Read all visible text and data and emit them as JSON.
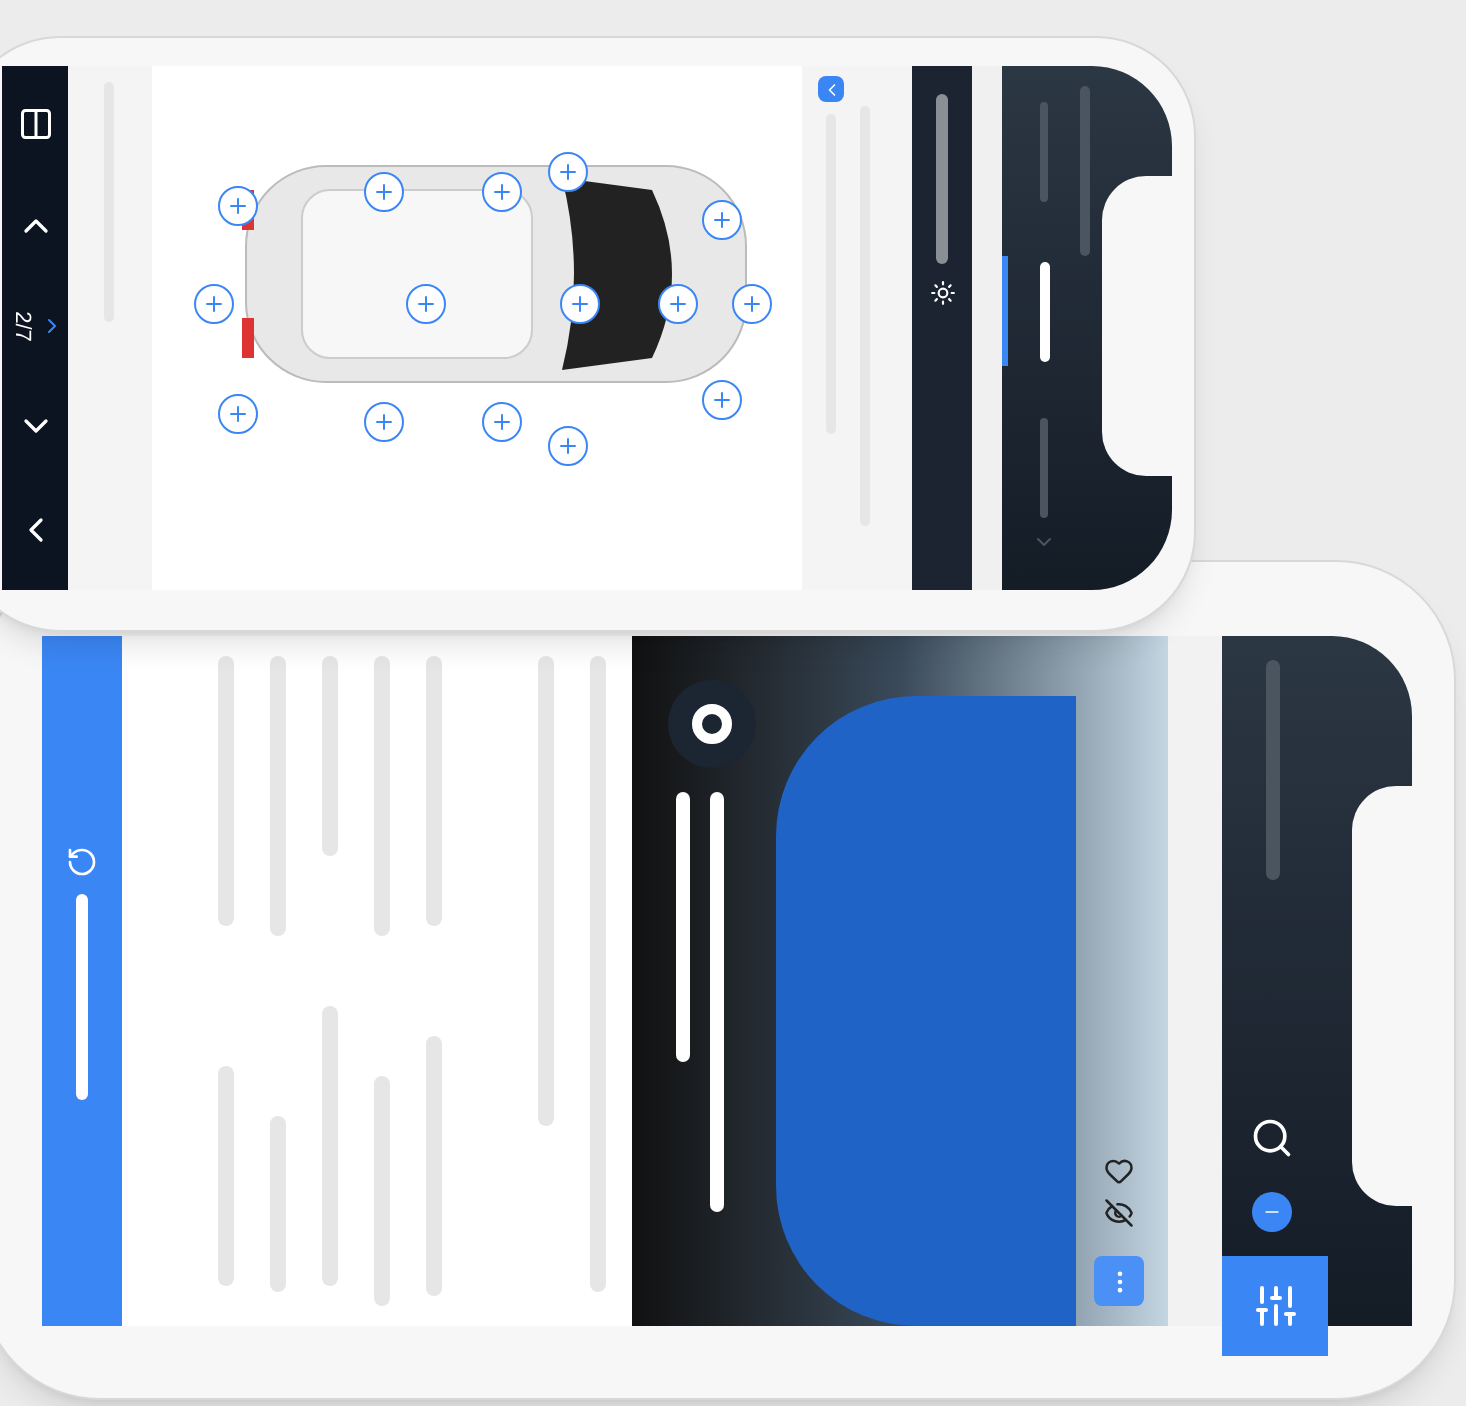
{
  "top_phone": {
    "pager": {
      "text": "2/7"
    }
  }
}
